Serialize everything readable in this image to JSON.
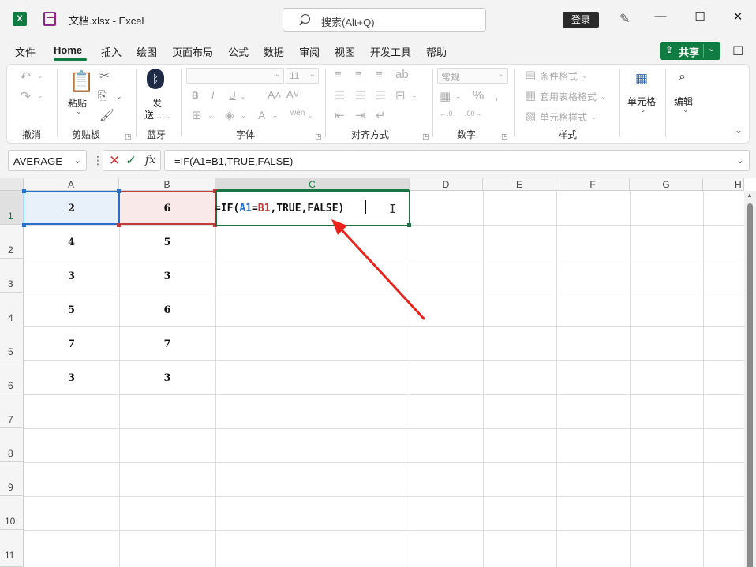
{
  "titlebar": {
    "app_icon": "X",
    "file_title": "文档.xlsx  -  Excel",
    "search_placeholder": "搜索(Alt+Q)",
    "login_label": "登录",
    "minimize": "—",
    "maximize": "☐",
    "close": "✕"
  },
  "menu": {
    "items": [
      "文件",
      "Home",
      "插入",
      "绘图",
      "页面布局",
      "公式",
      "数据",
      "审阅",
      "视图",
      "开发工具",
      "帮助"
    ],
    "active": "Home",
    "share_label": "共享"
  },
  "ribbon": {
    "groups": [
      "撤消",
      "剪贴板",
      "蓝牙",
      "字体",
      "对齐方式",
      "数字",
      "样式"
    ],
    "paste_label": "粘贴",
    "bluetooth_label_1": "发",
    "bluetooth_label_2": "送......",
    "number_format": "常规",
    "font_size": "11",
    "conditional_format": "条件格式",
    "table_format": "套用表格格式",
    "cell_style": "单元格样式",
    "cells_label": "单元格",
    "edit_label": "编辑"
  },
  "formula_bar": {
    "name_box": "AVERAGE",
    "formula": "=IF(A1=B1,TRUE,FALSE)"
  },
  "grid": {
    "columns": [
      "A",
      "B",
      "C",
      "D",
      "E",
      "F",
      "G",
      "H"
    ],
    "rows": [
      "1",
      "2",
      "3",
      "4",
      "5",
      "6",
      "7",
      "8",
      "9",
      "10",
      "11"
    ],
    "colA": [
      "2",
      "4",
      "3",
      "5",
      "7",
      "3"
    ],
    "colB": [
      "6",
      "5",
      "3",
      "6",
      "7",
      "3"
    ],
    "active_cell": "C1",
    "edit_formula": {
      "prefix": "=IF(",
      "ref_a": "A1",
      "eq": "=",
      "ref_b": "B1",
      "suffix": ",TRUE,FALSE)"
    }
  },
  "colors": {
    "accent": "#107c41",
    "ref_a": "#2b70c8",
    "ref_b": "#c03b3b",
    "arrow": "#e8231e"
  }
}
